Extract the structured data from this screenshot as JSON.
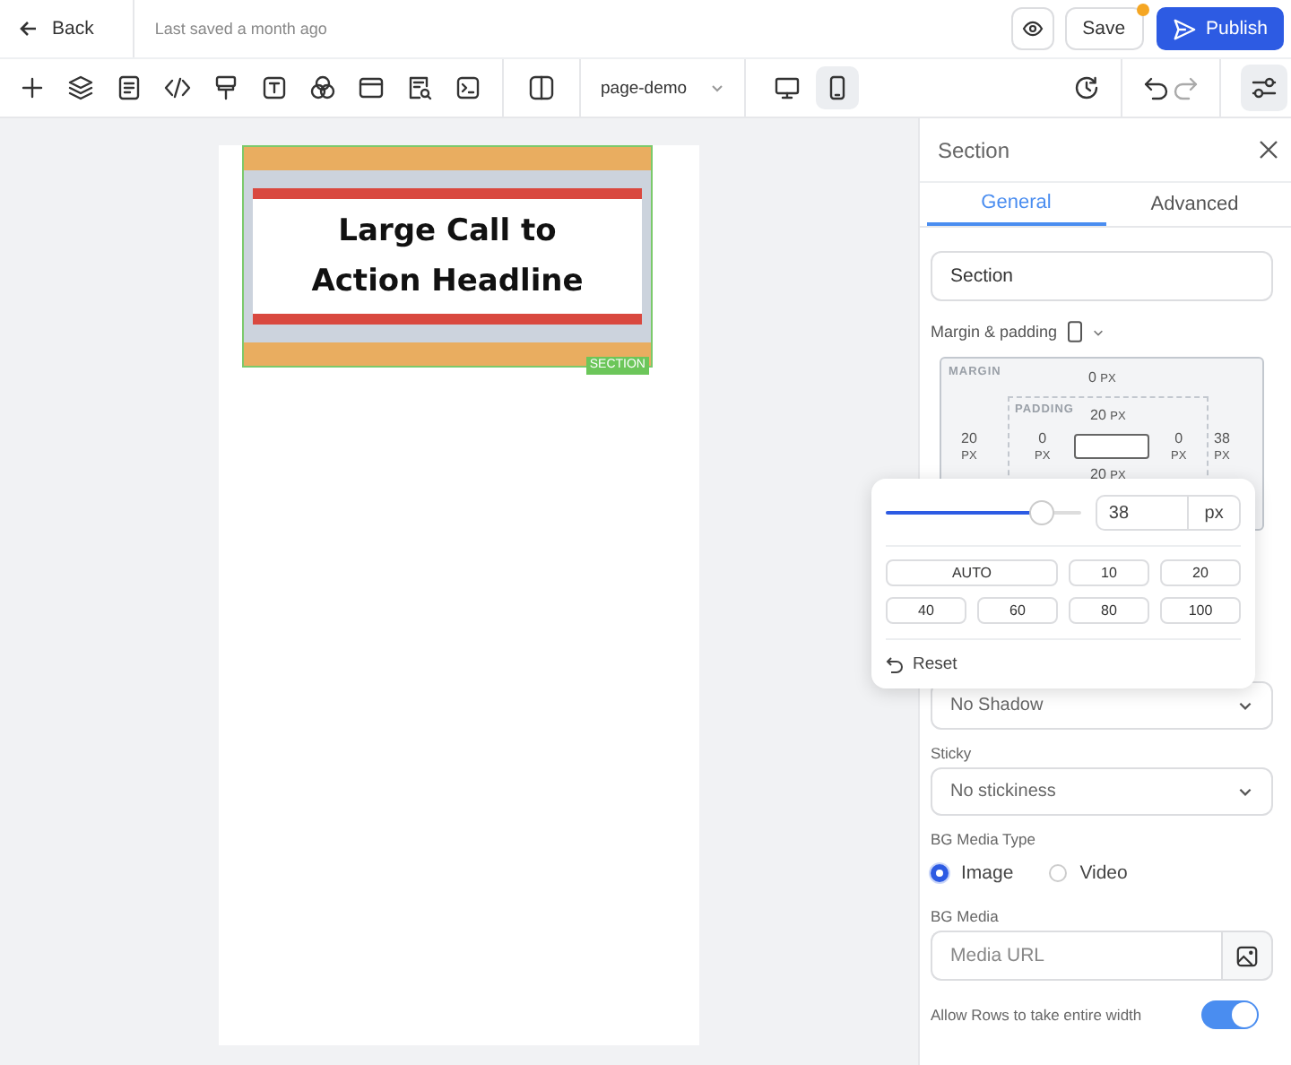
{
  "top_bar": {
    "back": "Back",
    "last_saved": "Last saved a month ago",
    "save": "Save",
    "publish": "Publish",
    "unsaved_dot": true
  },
  "toolbar": {
    "page_select": "page-demo",
    "devices": [
      {
        "kind": "desktop",
        "selected": false
      },
      {
        "kind": "mobile",
        "selected": true
      }
    ],
    "settings_selected": true
  },
  "canvas": {
    "headline": "Large Call to Action Headline",
    "section_tag": "SECTION"
  },
  "panel": {
    "title": "Section",
    "tabs": [
      {
        "label": "General",
        "selected": true
      },
      {
        "label": "Advanced",
        "selected": false
      }
    ],
    "element_name": "Section",
    "spacing_label": "Margin & padding",
    "margin": {
      "label": "MARGIN",
      "top": {
        "value": "0",
        "unit": "PX"
      },
      "left": {
        "value": "20",
        "unit": "PX"
      },
      "right": {
        "value": "38",
        "unit": "PX"
      }
    },
    "padding": {
      "label": "PADDING",
      "top": {
        "value": "20",
        "unit": "PX"
      },
      "left": {
        "value": "0",
        "unit": "PX"
      },
      "right": {
        "value": "0",
        "unit": "PX"
      },
      "bottom": {
        "value": "20",
        "unit": "PX"
      }
    },
    "shadow": "No Shadow",
    "sticky": {
      "label": "Sticky",
      "value": "No stickiness"
    },
    "bg_media_type": {
      "label": "BG Media Type",
      "options": [
        {
          "label": "Image",
          "selected": true
        },
        {
          "label": "Video",
          "selected": false
        }
      ]
    },
    "bg_media": {
      "label": "BG Media",
      "placeholder": "Media URL"
    },
    "full_width": {
      "label": "Allow Rows to take entire width",
      "on": true
    }
  },
  "popover": {
    "level": 0.84,
    "value": "38",
    "unit": "px",
    "presets": [
      "AUTO",
      "10",
      "20",
      "40",
      "60",
      "80",
      "100"
    ],
    "reset": "Reset"
  }
}
